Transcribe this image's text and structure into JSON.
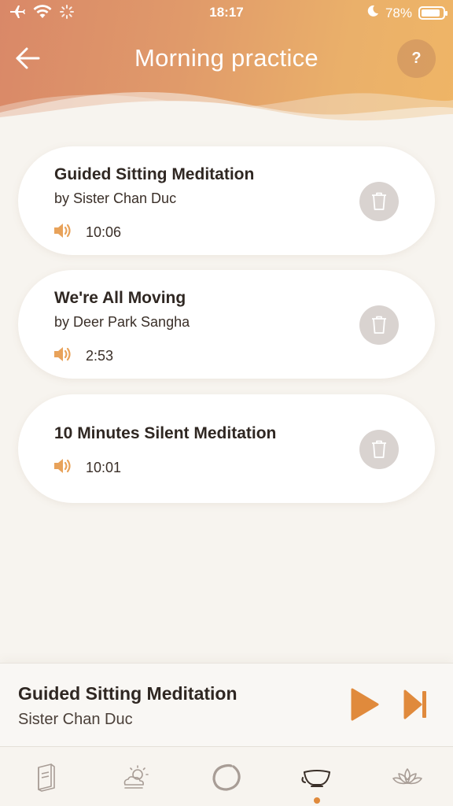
{
  "status_bar": {
    "time": "18:17",
    "battery": "78%",
    "battery_level": 0.78
  },
  "header": {
    "title": "Morning practice",
    "help_label": "?"
  },
  "items": [
    {
      "title": "Guided Sitting Meditation",
      "author": "by Sister Chan Duc",
      "duration": "10:06"
    },
    {
      "title": "We're All Moving",
      "author": "by Deer Park Sangha",
      "duration": "2:53"
    },
    {
      "title": "10 Minutes Silent Meditation",
      "author": "",
      "duration": "10:01"
    }
  ],
  "player": {
    "title": "Guided Sitting Meditation",
    "author": "Sister Chan Duc"
  },
  "tabs": [
    {
      "icon": "book-icon"
    },
    {
      "icon": "weather-icon"
    },
    {
      "icon": "enso-circle-icon"
    },
    {
      "icon": "tea-bowl-icon",
      "active": true
    },
    {
      "icon": "lotus-icon"
    }
  ],
  "colors": {
    "accent": "#e08a3c",
    "header_start": "#d98868",
    "header_end": "#efb566"
  }
}
